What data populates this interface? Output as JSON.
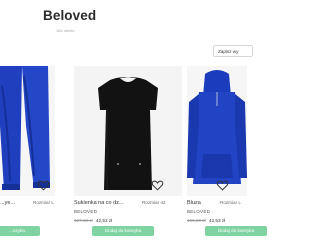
{
  "header": {
    "title": "Beloved",
    "subtitle": "184 obiekt"
  },
  "save_search": {
    "label": "Zapisz wy"
  },
  "products": [
    {
      "title": "...ye...",
      "size": "Rozmiar L",
      "brand": "",
      "old_price": "",
      "new_price": "",
      "cart": "...szyka"
    },
    {
      "title": "Sukienka na co dz...",
      "size": "Rozmiar 42",
      "brand": "BELOVED",
      "old_price": "127,60 zł",
      "new_price": "42,53 zł",
      "cart": "Dodaj do koszyka"
    },
    {
      "title": "Bluza",
      "size": "Rozmiar L",
      "brand": "BELOVED",
      "old_price": "106,39 zł",
      "new_price": "42,53 zł",
      "cart": "Dodaj do koszyka"
    }
  ],
  "colors": {
    "accent_green": "#7fd3a0",
    "royal_blue": "#1f3fbf",
    "garment_black": "#111111"
  },
  "icons": {
    "favorite": "heart-icon"
  }
}
